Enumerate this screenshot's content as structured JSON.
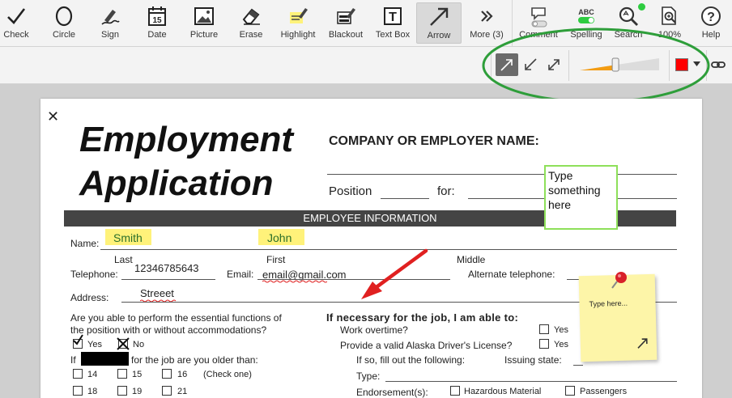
{
  "toolbar": {
    "tools": [
      {
        "label": "Check",
        "icon": "check-icon"
      },
      {
        "label": "Circle",
        "icon": "circle-icon"
      },
      {
        "label": "Sign",
        "icon": "sign-icon"
      },
      {
        "label": "Date",
        "icon": "calendar-icon",
        "date_num": "15"
      },
      {
        "label": "Picture",
        "icon": "picture-icon"
      },
      {
        "label": "Erase",
        "icon": "eraser-icon"
      },
      {
        "label": "Highlight",
        "icon": "highlight-icon"
      },
      {
        "label": "Blackout",
        "icon": "blackout-icon"
      },
      {
        "label": "Text Box",
        "icon": "textbox-icon",
        "glyph": "T"
      },
      {
        "label": "Arrow",
        "icon": "arrow-icon",
        "active": true
      },
      {
        "label": "More (3)",
        "icon": "double-chevron-icon"
      }
    ],
    "right_tools": [
      {
        "label": "Comment",
        "icon": "comment-icon"
      },
      {
        "label": "Spelling",
        "icon": "spelling-icon",
        "badge": "ABC"
      },
      {
        "label": "Search",
        "icon": "search-icon"
      },
      {
        "label": "100%",
        "icon": "zoom-icon"
      },
      {
        "label": "Help",
        "icon": "help-icon",
        "glyph": "?"
      }
    ]
  },
  "arrow_options": {
    "styles": [
      "arrow-end-icon",
      "arrow-start-icon",
      "arrow-both-icon"
    ],
    "selected_style": 0,
    "line_width_percent": 45,
    "color": "#ff0000"
  },
  "document": {
    "close_glyph": "✕",
    "title_line1": "Employment",
    "title_line2": "Application",
    "company_label": "COMPANY OR EMPLOYER NAME:",
    "position_label": "Position",
    "for_label": "for:",
    "section_header": "EMPLOYEE INFORMATION",
    "name_label": "Name:",
    "name_first_value": "Smith",
    "name_last_value": "John",
    "last_caption": "Last",
    "first_caption": "First",
    "middle_caption": "Middle",
    "telephone_label": "Telephone:",
    "telephone_value": "12346785643",
    "email_label": "Email:",
    "email_value": "email@gmail.com",
    "alt_phone_label": "Alternate telephone:",
    "address_label": "Address:",
    "address_value": "Streeet",
    "essential_q_line1": "Are you able to perform the essential functions of",
    "essential_q_line2": "the position with or without accommodations?",
    "yes_label": "Yes",
    "no_label": "No",
    "if_label": "If",
    "older_than_label": "for the job are you older than:",
    "ages_row1": [
      "14",
      "15",
      "16"
    ],
    "ages_row2": [
      "18",
      "19",
      "21"
    ],
    "check_one": "(Check one)",
    "necessary_heading": "If necessary for the job, I am able to:",
    "work_overtime": "Work overtime?",
    "drivers_license": "Provide a valid Alaska Driver's License?",
    "if_so_fill": "If so, fill out the following:",
    "issuing_state": "Issuing state:",
    "type_label": "Type:",
    "endorsement_label": "Endorsement(s):",
    "hazardous": "Hazardous Material",
    "passengers": "Passengers",
    "textbox_text": "Type something here",
    "sticky_text": "Type here..."
  },
  "colors": {
    "accent_green": "#2e9e3a",
    "highlight": "#fff27a",
    "arrow_red": "#e02020",
    "section_bar": "#444444"
  }
}
